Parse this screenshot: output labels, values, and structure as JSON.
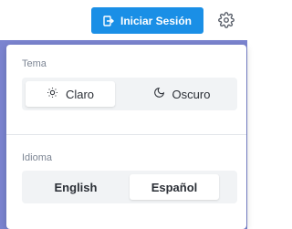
{
  "header": {
    "login_label": "Iniciar Sesión",
    "login_icon": "login-icon",
    "settings_icon": "gear-icon"
  },
  "settings": {
    "theme": {
      "label": "Tema",
      "options": [
        {
          "label": "Claro",
          "icon": "sun-icon",
          "selected": true
        },
        {
          "label": "Oscuro",
          "icon": "moon-icon",
          "selected": false
        }
      ]
    },
    "language": {
      "label": "Idioma",
      "options": [
        {
          "label": "English",
          "selected": false
        },
        {
          "label": "Español",
          "selected": true
        }
      ]
    }
  },
  "colors": {
    "accent": "#1a8fe6",
    "backdrop": "#7b84d0"
  }
}
